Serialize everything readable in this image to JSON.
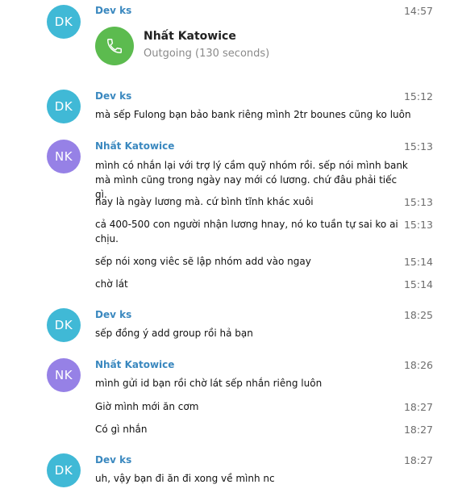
{
  "messages": [
    {
      "author": "Dev ks",
      "initials": "DK",
      "time": "14:57",
      "call": {
        "title": "Nhất Katowice",
        "status": "Outgoing (130 seconds)"
      }
    },
    {
      "author": "Dev ks",
      "initials": "DK",
      "time": "15:12",
      "text": "mà sếp Fulong bạn bảo bank riêng mình 2tr bounes cũng ko luôn"
    },
    {
      "author": "Nhất Katowice",
      "initials": "NK",
      "time": "15:13",
      "text": "mình có nhắn lại với trợ lý cầm quỹ nhóm rồi. sếp nói mình bank mà mình cũng trong ngày nay mới có lương. chứ đâu phải tiếc gì."
    },
    {
      "time": "15:13",
      "text": "nay là ngày lương mà. cứ bình tĩnh khác xuôi"
    },
    {
      "time": "15:13",
      "text": "cả 400-500 con người nhận lương hnay, nó ko tuần tự sai ko ai chịu."
    },
    {
      "time": "15:14",
      "text": "sếp nói xong viêc sẽ lập nhóm add vào ngay"
    },
    {
      "time": "15:14",
      "text": "chờ lát"
    },
    {
      "author": "Dev ks",
      "initials": "DK",
      "time": "18:25",
      "text": "sếp đồng ý add group rồi hả bạn"
    },
    {
      "author": "Nhất Katowice",
      "initials": "NK",
      "time": "18:26",
      "text": "mình gửi id bạn rồi chờ lát sếp nhắn riêng luôn"
    },
    {
      "time": "18:27",
      "text": "Giờ mình mới ăn cơm"
    },
    {
      "time": "18:27",
      "text": "Có gì nhắn"
    },
    {
      "author": "Dev ks",
      "initials": "DK",
      "time": "18:27",
      "text": "uh, vậy bạn đi ăn đi xong về mình nc"
    }
  ],
  "colors": {
    "dk_avatar": "#40b9d6",
    "nk_avatar": "#9681e6",
    "name": "#3a88bf",
    "call_icon": "#5cbb4f"
  },
  "icons": {
    "call": "phone-icon"
  }
}
